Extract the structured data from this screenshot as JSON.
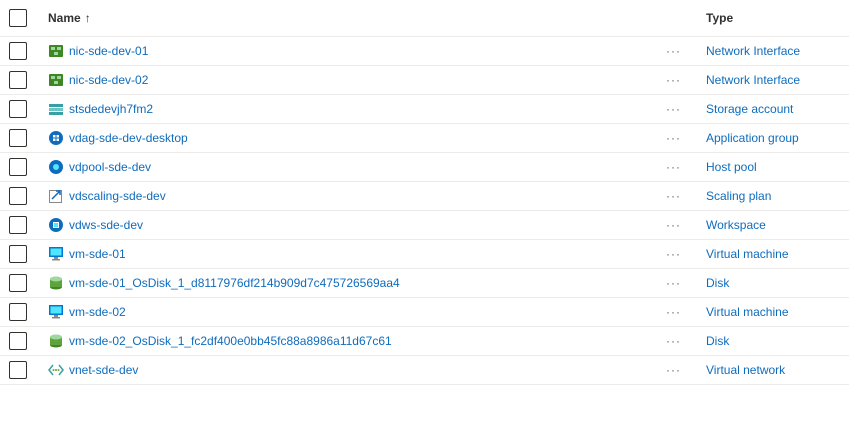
{
  "header": {
    "name_label": "Name",
    "sort_indicator": "↑",
    "type_label": "Type"
  },
  "more_label": "···",
  "rows": [
    {
      "name": "nic-sde-dev-01",
      "type": "Network Interface",
      "icon": "network-interface-icon"
    },
    {
      "name": "nic-sde-dev-02",
      "type": "Network Interface",
      "icon": "network-interface-icon"
    },
    {
      "name": "stsdedevjh7fm2",
      "type": "Storage account",
      "icon": "storage-account-icon"
    },
    {
      "name": "vdag-sde-dev-desktop",
      "type": "Application group",
      "icon": "application-group-icon"
    },
    {
      "name": "vdpool-sde-dev",
      "type": "Host pool",
      "icon": "host-pool-icon"
    },
    {
      "name": "vdscaling-sde-dev",
      "type": "Scaling plan",
      "icon": "scaling-plan-icon"
    },
    {
      "name": "vdws-sde-dev",
      "type": "Workspace",
      "icon": "workspace-icon"
    },
    {
      "name": "vm-sde-01",
      "type": "Virtual machine",
      "icon": "virtual-machine-icon"
    },
    {
      "name": "vm-sde-01_OsDisk_1_d8117976df214b909d7c475726569aa4",
      "type": "Disk",
      "icon": "disk-icon"
    },
    {
      "name": "vm-sde-02",
      "type": "Virtual machine",
      "icon": "virtual-machine-icon"
    },
    {
      "name": "vm-sde-02_OsDisk_1_fc2df400e0bb45fc88a8986a11d67c61",
      "type": "Disk",
      "icon": "disk-icon"
    },
    {
      "name": "vnet-sde-dev",
      "type": "Virtual network",
      "icon": "virtual-network-icon"
    }
  ],
  "colors": {
    "link": "#0f6cbd",
    "divider": "#edebe9",
    "text": "#323130"
  }
}
